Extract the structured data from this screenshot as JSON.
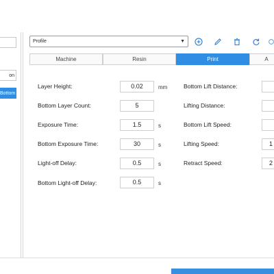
{
  "left_panel": {
    "items": [
      {
        "label": ""
      },
      {
        "label": "on"
      },
      {
        "label": "Bottom E"
      }
    ]
  },
  "profile": {
    "value": "Profile"
  },
  "tabs": [
    {
      "label": "Machine"
    },
    {
      "label": "Resin"
    },
    {
      "label": "Print"
    },
    {
      "label": "A"
    }
  ],
  "settings_left": [
    {
      "label": "Layer Height:",
      "value": "0.02",
      "unit": "mm"
    },
    {
      "label": "Bottom Layer Count:",
      "value": "5",
      "unit": ""
    },
    {
      "label": "Exposure Time:",
      "value": "1.5",
      "unit": "s"
    },
    {
      "label": "Bottom Exposure Time:",
      "value": "30",
      "unit": "s"
    },
    {
      "label": "Light-off Delay:",
      "value": "0.5",
      "unit": "s"
    },
    {
      "label": "Bottom Light-off Delay:",
      "value": "0.5",
      "unit": "s"
    }
  ],
  "settings_right": [
    {
      "label": "Bottom Lift Distance:",
      "value": ""
    },
    {
      "label": "Lifting Distance:",
      "value": ""
    },
    {
      "label": "Bottom Lift Speed:",
      "value": ""
    },
    {
      "label": "Lifting Speed:",
      "value": "1"
    },
    {
      "label": "Retract Speed:",
      "value": "2"
    }
  ],
  "colors": {
    "accent": "#2f8de4",
    "icon": "#3a86d6"
  }
}
